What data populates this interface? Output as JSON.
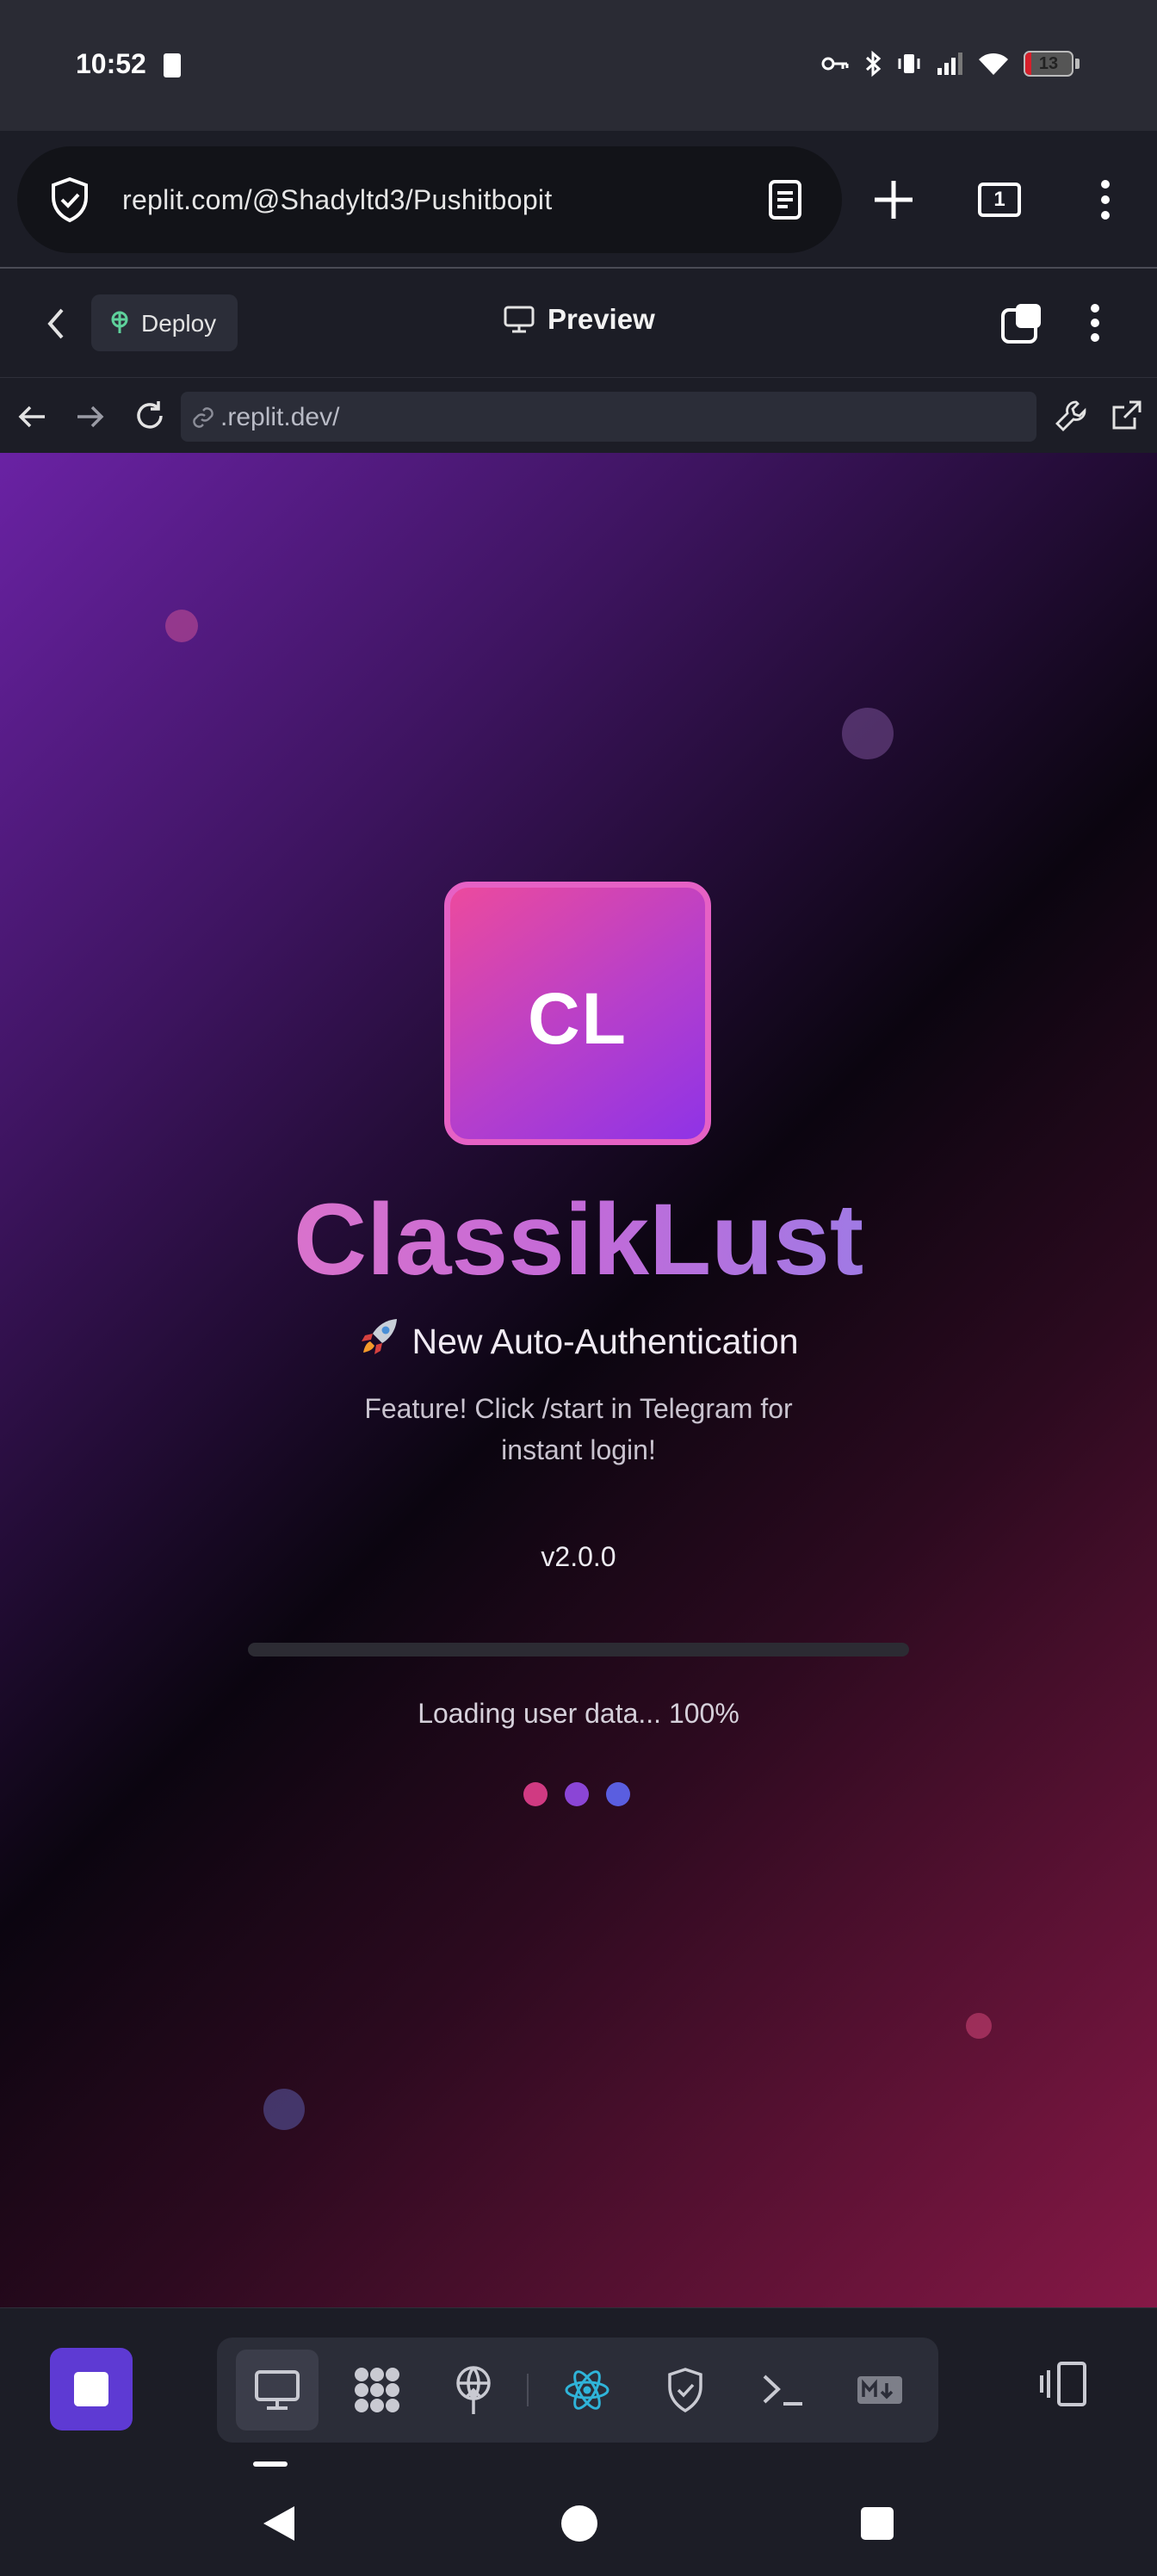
{
  "status_bar": {
    "time": "10:52",
    "battery_level": "13",
    "battery_percent": 13
  },
  "browser": {
    "url": "replit.com/@Shadyltd3/Pushitbopit",
    "tab_count": "1"
  },
  "replit_header": {
    "deploy_label": "Deploy",
    "preview_label": "Preview"
  },
  "preview_bar": {
    "url": ".replit.dev/"
  },
  "app": {
    "logo_text": "CL",
    "title": "ClassikLust",
    "feature_heading": "New Auto-Authentication",
    "feature_text": "Feature! Click /start in Telegram for instant login!",
    "version": "v2.0.0",
    "loading_text": "Loading user data... 100%",
    "progress_percent": 100,
    "colors": {
      "gradient_top_left": "#6a22a4",
      "gradient_bottom_right": "#861846",
      "logo_pink": "#ec4a9e",
      "logo_purple": "#8f33e6",
      "dot_pink": "#d03a82",
      "dot_purple": "#8b45d6",
      "dot_blue": "#5a5ee0"
    }
  },
  "toolbar": {
    "tools": [
      "preview-icon",
      "workflows-icon",
      "deployments-icon",
      "react-icon",
      "secrets-icon",
      "shell-icon",
      "markdown-icon"
    ],
    "active_tool": "preview-icon",
    "accent_color": "#5e3ad3"
  }
}
